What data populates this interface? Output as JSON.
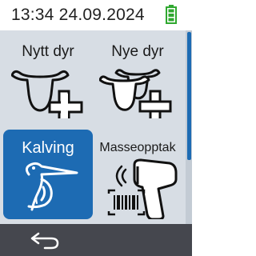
{
  "status": {
    "time": "13:34",
    "date": "24.09.2024",
    "battery_icon": "battery-icon",
    "battery_color": "#2fa82f"
  },
  "menu": {
    "tiles": [
      {
        "label": "Nytt dyr",
        "icon": "single-cow-plus-icon"
      },
      {
        "label": "Nye dyr",
        "icon": "multiple-cows-plus-icon"
      },
      {
        "label": "Kalving",
        "icon": "stork-icon",
        "selected": true
      },
      {
        "label": "Masseopptak",
        "icon": "barcode-scanner-icon"
      }
    ]
  },
  "bottom": {
    "back_icon": "back-arrow-icon"
  },
  "colors": {
    "accent": "#1d6bb3",
    "background": "#d7dde4",
    "bottom_bar": "#45474e"
  }
}
